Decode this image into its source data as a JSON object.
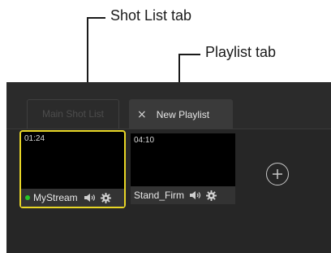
{
  "callouts": {
    "shot_list_tab": "Shot List tab",
    "playlist_tab": "Playlist tab"
  },
  "tabs": [
    {
      "label": "Main Shot List",
      "active": false
    },
    {
      "label": "New Playlist",
      "active": true,
      "close_symbol": "×"
    }
  ],
  "shots": [
    {
      "time": "01:24",
      "name": "MyStream",
      "live": true,
      "selected": true,
      "icons": [
        "speaker-icon",
        "gear-icon"
      ]
    },
    {
      "time": "04:10",
      "name": "Stand_Firm",
      "live": false,
      "selected": false,
      "icons": [
        "speaker-icon",
        "gear-icon"
      ]
    }
  ],
  "add_button": {
    "icon": "plus-circle-icon"
  },
  "colors": {
    "selection": "#e8d626",
    "live_indicator": "#27c427",
    "panel_background": "#262626"
  }
}
